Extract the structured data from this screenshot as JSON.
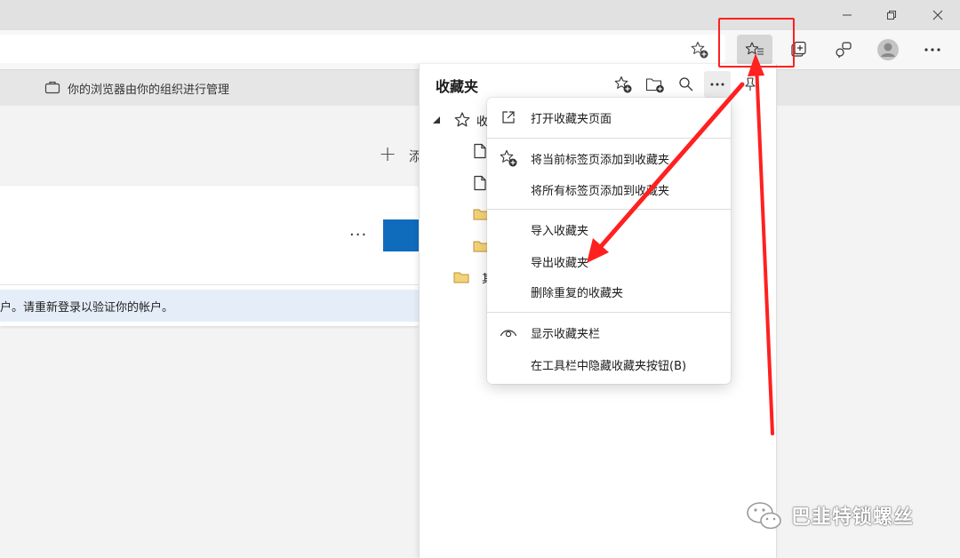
{
  "managed_bar": {
    "text": "你的浏览器由你的组织进行管理"
  },
  "page": {
    "add_label": "添",
    "add_plus": "+",
    "card_more": "...",
    "notice_text": "户。请重新登录以验证你的帐户。"
  },
  "favorites": {
    "title": "收藏夹",
    "root_label": "收",
    "other_label": "其"
  },
  "menu": {
    "items": [
      {
        "label": "打开收藏夹页面",
        "icon": "open-external-icon"
      },
      {
        "label": "将当前标签页添加到收藏夹",
        "icon": "star-add-icon"
      },
      {
        "label": "将所有标签页添加到收藏夹",
        "icon": ""
      },
      {
        "label": "导入收藏夹",
        "icon": ""
      },
      {
        "label": "导出收藏夹",
        "icon": ""
      },
      {
        "label": "删除重复的收藏夹",
        "icon": ""
      },
      {
        "label": "显示收藏夹栏",
        "icon": "eye-icon"
      },
      {
        "label": "在工具栏中隐藏收藏夹按钮(B)",
        "icon": ""
      }
    ]
  },
  "watermark": {
    "text": "巴韭特锁螺丝"
  },
  "colors": {
    "accent_blue": "#0f6cbd",
    "annotation_red": "#ff2020",
    "folder_yellow": "#f4d27a",
    "notice_bg": "#e5eef8"
  }
}
